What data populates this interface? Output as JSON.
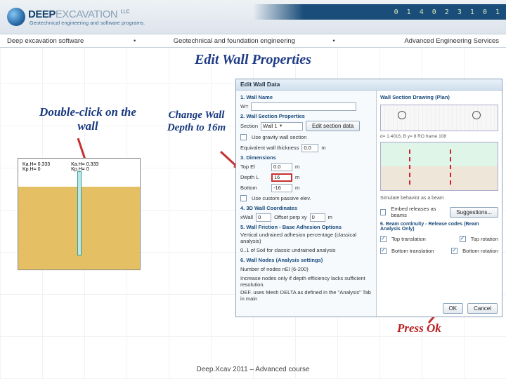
{
  "header": {
    "brand": "DEEP",
    "brand2": "EXCAVATION",
    "suffix": "LLC",
    "tagline": "Geotechnical engineering and software programs.",
    "digits": "0 1 4 0 2 3 1 0 1"
  },
  "bar": {
    "left": "Deep excavation software",
    "mid": "Geotechnical and foundation engineering",
    "right": "Advanced Engineering Services",
    "sep": "•"
  },
  "title": "Edit Wall Properties",
  "callouts": {
    "left": "Double-click on the wall",
    "mid": "Change Wall Depth to 16m",
    "ok": "Press Ok"
  },
  "soil": {
    "ka_left": "Ka.H= 0.333",
    "kp_left": "Kp.H= 0",
    "ka_right": "Ka.H= 0.333",
    "kp_right": "Kp.H= 0"
  },
  "dialog": {
    "title": "Edit Wall Data",
    "s1": "1. Wall Name",
    "name_label": "W=",
    "name_value": "",
    "s2": "2. Wall Section Properties",
    "section_label": "Section",
    "section_value": "Wall 1",
    "edit_section": "Edit section data",
    "gravity_label": "Use gravity wall section",
    "equiv_label": "Equivalent wall thickness",
    "equiv_value": "0.0",
    "unit_m": "m",
    "s3": "3. Dimensions",
    "top_el_label": "Top El",
    "top_el_value": "0.0",
    "depth_label": "Depth L",
    "depth_value": "16",
    "bottom_label": "Bottom",
    "bottom_value": "-16",
    "custom_passive": "Use custom passive elev.",
    "s4": "4. 3D Wall Coordinates",
    "xwall_label": "xWall",
    "xwall_value": "0",
    "offset_label": "Offset perp xy",
    "offset_value": "0",
    "s5": "5. Wall Friction - Base Adhesion Options",
    "adhesion_label": "Vertical undrained adhesion percentage (classical analysis)",
    "friction_label": "0..1 of Soil for classic undrained analysis",
    "s6": "6. Wall Nodes (Analysis settings)",
    "nodes_label": "Number of nodes nEl (6-200)",
    "nodes_note1": "Increase nodes only if depth efficiency lacks sufficient resolution.",
    "nodes_note2": "DEF. uses Mesh DELTA as defined in the \"Analysis\" Tab in main",
    "right_title": "Wall Section Drawing (Plan)",
    "section_id": "d= 1.4016, B y= 8   RO frame 108",
    "sim_label": "Simulate behavior as a beam",
    "embed_label": "Embed releases as beams",
    "suggestions": "Suggestions...",
    "beam_label": "6. Beam continuity - Release codes (Beam Analysis Only)",
    "top_translation": "Top translation",
    "top_rotation": "Top rotation",
    "bot_translation": "Bottom translation",
    "bot_rotation": "Bottom rotation",
    "ok": "OK",
    "cancel": "Cancel"
  },
  "footer": "Deep.Xcav 2011 – Advanced course"
}
